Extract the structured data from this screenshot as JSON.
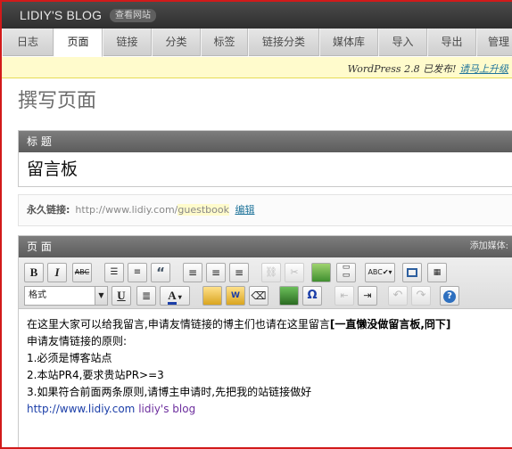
{
  "topbar": {
    "blog_title": "LIDIY'S BLOG",
    "view_site": "查看网站"
  },
  "tabs": [
    {
      "label": "日志"
    },
    {
      "label": "页面"
    },
    {
      "label": "链接"
    },
    {
      "label": "分类"
    },
    {
      "label": "标签"
    },
    {
      "label": "链接分类"
    },
    {
      "label": "媒体库"
    },
    {
      "label": "导入"
    },
    {
      "label": "导出"
    },
    {
      "label": "管理"
    }
  ],
  "active_tab": "页面",
  "notice": {
    "text": "WordPress 2.8 已发布! ",
    "link": "请马上升级"
  },
  "page_heading": "撰写页面",
  "title_box": {
    "header": "标 题",
    "value": "留言板"
  },
  "permalink": {
    "label": "永久链接:",
    "url_prefix": "http://www.lidiy.com/",
    "slug": "guestbook",
    "edit_link": "编辑"
  },
  "editor": {
    "header": "页 面",
    "add_media": "添加媒体:",
    "format_select": "格式",
    "toolbar_icons": [
      "bold-icon",
      "italic-icon",
      "strikethrough-icon",
      "bullet-list-icon",
      "numbered-list-icon",
      "blockquote-icon",
      "align-left-icon",
      "align-center-icon",
      "align-right-icon",
      "link-icon",
      "unlink-icon",
      "insert-image-icon",
      "more-tag-icon",
      "spellcheck-icon",
      "fullscreen-icon",
      "kitchen-sink-icon",
      "underline-icon",
      "justify-icon",
      "text-color-icon",
      "paste-text-icon",
      "paste-word-icon",
      "remove-format-icon",
      "media-icon",
      "special-char-icon",
      "outdent-icon",
      "indent-icon",
      "undo-icon",
      "redo-icon",
      "help-icon"
    ],
    "content": {
      "line1_text": "在这里大家可以给我留言,申请友情链接的博主们也请在这里留言",
      "line1_bold": "[一直懒没做留言板,冏下]",
      "line2": "申请友情链接的原则:",
      "line3": "1.必须是博客站点",
      "line4": "2.本站PR4,要求贵站PR>=3",
      "line5": "3.如果符合前面两条原则,请博主申请时,先把我的站链接做好",
      "link_url": "http://www.lidiy.com",
      "link_name": "lidiy's blog"
    }
  }
}
